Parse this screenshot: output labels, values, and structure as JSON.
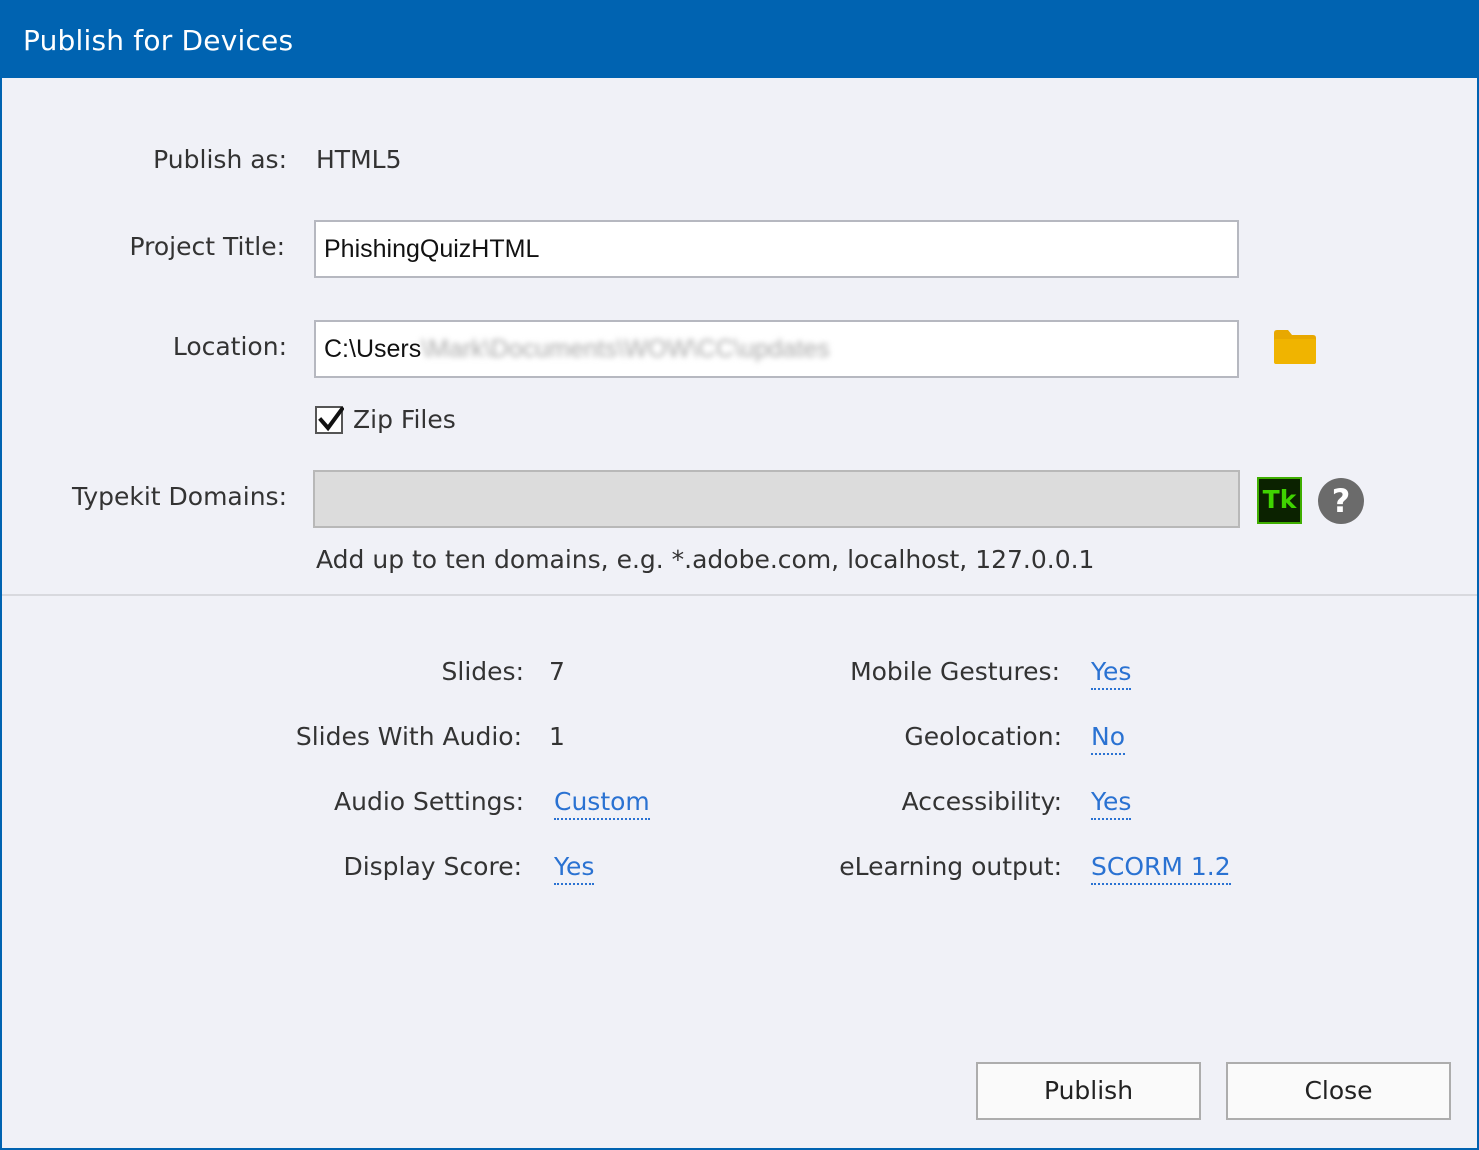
{
  "window": {
    "title": "Publish for Devices"
  },
  "form": {
    "publish_as_label": "Publish as:",
    "publish_as_value": "HTML5",
    "project_title_label": "Project Title:",
    "project_title_value": "PhishingQuizHTML",
    "location_label": "Location:",
    "location_value_visible": "C:\\Users",
    "location_value_obscured": "\\Mark\\Documents\\WOW\\CC\\updates",
    "zip_files_label": "Zip Files",
    "zip_files_checked": true,
    "typekit_label": "Typekit Domains:",
    "typekit_value": "",
    "typekit_icon_text": "Tk",
    "help_icon_text": "?",
    "typekit_hint": "Add up to ten domains, e.g. *.adobe.com, localhost, 127.0.0.1"
  },
  "summary": {
    "left": [
      {
        "label": "Slides:",
        "value": "7"
      },
      {
        "label": "Slides With Audio:",
        "value": "1"
      },
      {
        "label": "Audio Settings:",
        "value": "Custom"
      },
      {
        "label": "Display Score:",
        "value": "Yes"
      }
    ],
    "right": [
      {
        "label": "Mobile Gestures:",
        "value": "Yes"
      },
      {
        "label": "Geolocation:",
        "value": "No"
      },
      {
        "label": "Accessibility:",
        "value": "Yes"
      },
      {
        "label": "eLearning output:",
        "value": "SCORM 1.2"
      }
    ]
  },
  "buttons": {
    "publish": "Publish",
    "close": "Close"
  },
  "colors": {
    "titlebar": "#0063b1",
    "background": "#f0f1f7",
    "link": "#2a72d2",
    "folder": "#e8a800",
    "typekit_green": "#3fd300"
  }
}
